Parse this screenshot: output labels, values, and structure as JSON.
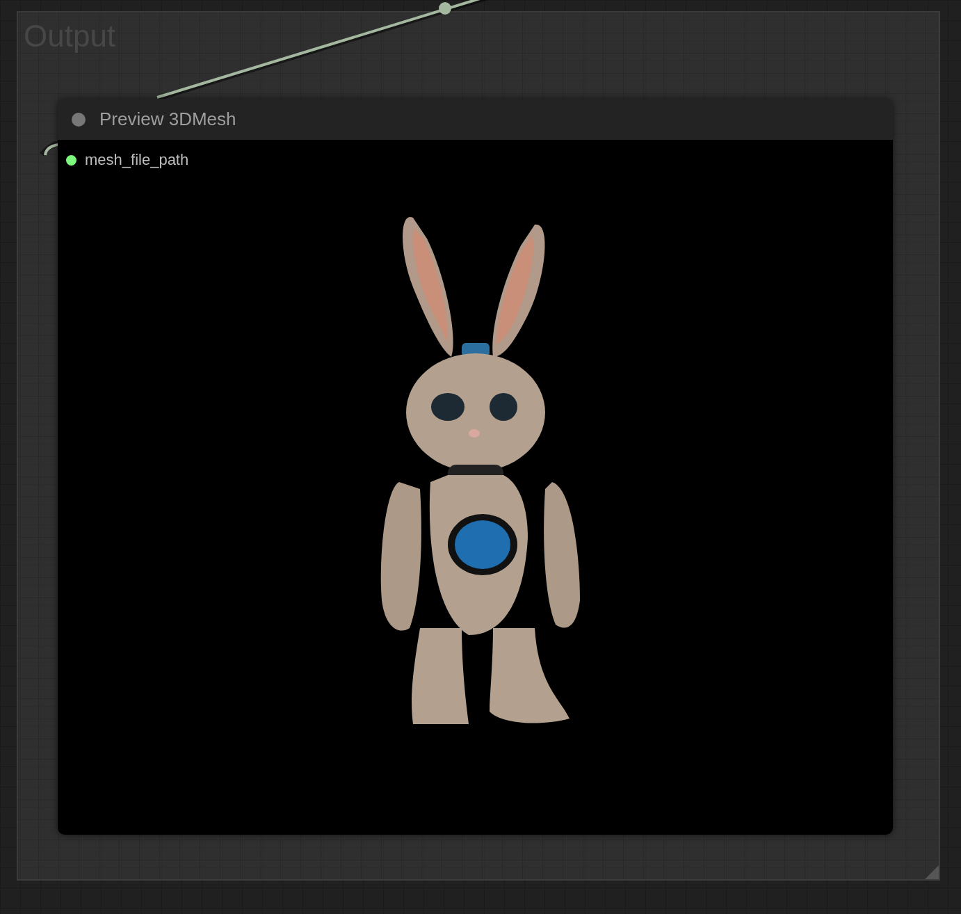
{
  "group": {
    "title": "Output"
  },
  "node": {
    "title": "Preview 3DMesh",
    "inputs": [
      {
        "name": "mesh_file_path",
        "connected": true
      }
    ]
  }
}
